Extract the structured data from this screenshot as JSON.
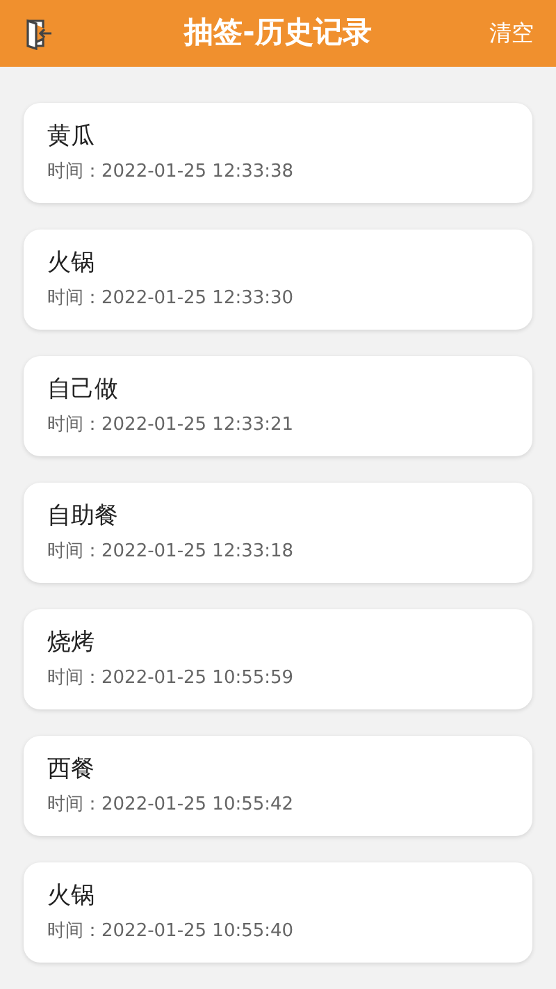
{
  "header": {
    "title": "抽签-历史记录",
    "action": "清空"
  },
  "records": [
    {
      "name": "黄瓜",
      "time": "时间：2022-01-25 12:33:38"
    },
    {
      "name": "火锅",
      "time": "时间：2022-01-25 12:33:30"
    },
    {
      "name": "自己做",
      "time": "时间：2022-01-25 12:33:21"
    },
    {
      "name": "自助餐",
      "time": "时间：2022-01-25 12:33:18"
    },
    {
      "name": "烧烤",
      "time": "时间：2022-01-25 10:55:59"
    },
    {
      "name": "西餐",
      "time": "时间：2022-01-25 10:55:42"
    },
    {
      "name": "火锅",
      "time": "时间：2022-01-25 10:55:40"
    }
  ]
}
